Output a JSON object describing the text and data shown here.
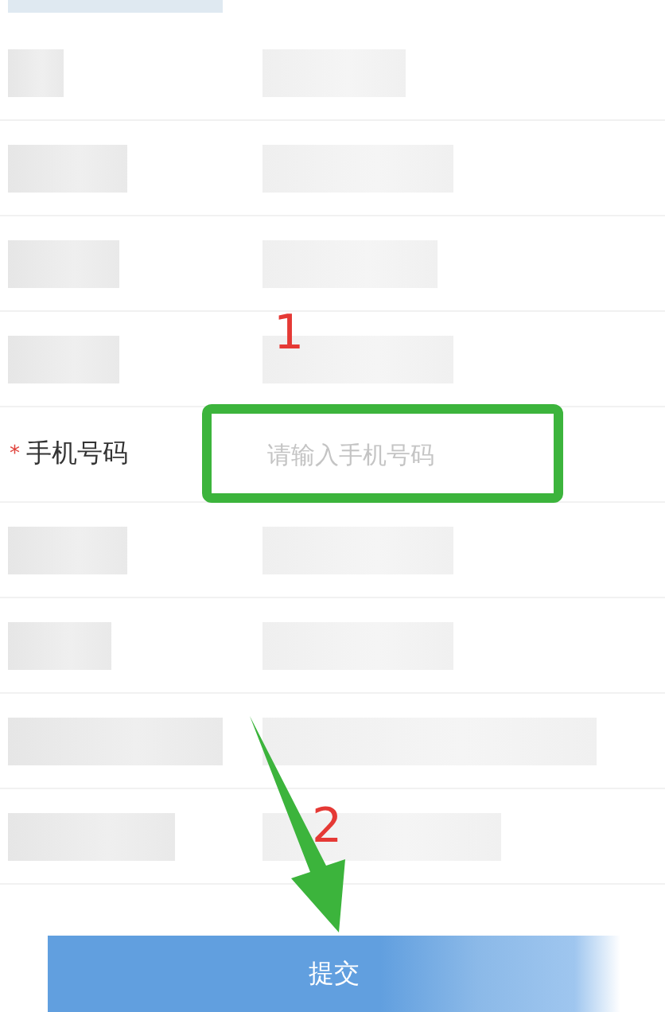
{
  "rows": [
    {
      "kind": "redacted"
    },
    {
      "kind": "redacted"
    },
    {
      "kind": "redacted"
    },
    {
      "kind": "redacted"
    },
    {
      "kind": "field",
      "required_mark": "*",
      "label": "手机号码",
      "placeholder": "请输入手机号码"
    },
    {
      "kind": "redacted"
    },
    {
      "kind": "redacted"
    },
    {
      "kind": "redacted"
    },
    {
      "kind": "redacted"
    }
  ],
  "submit_button": "提交",
  "annotations": [
    {
      "kind": "highlight"
    },
    {
      "kind": "number",
      "text": "1"
    },
    {
      "kind": "arrow"
    },
    {
      "kind": "number",
      "text": "2"
    }
  ]
}
